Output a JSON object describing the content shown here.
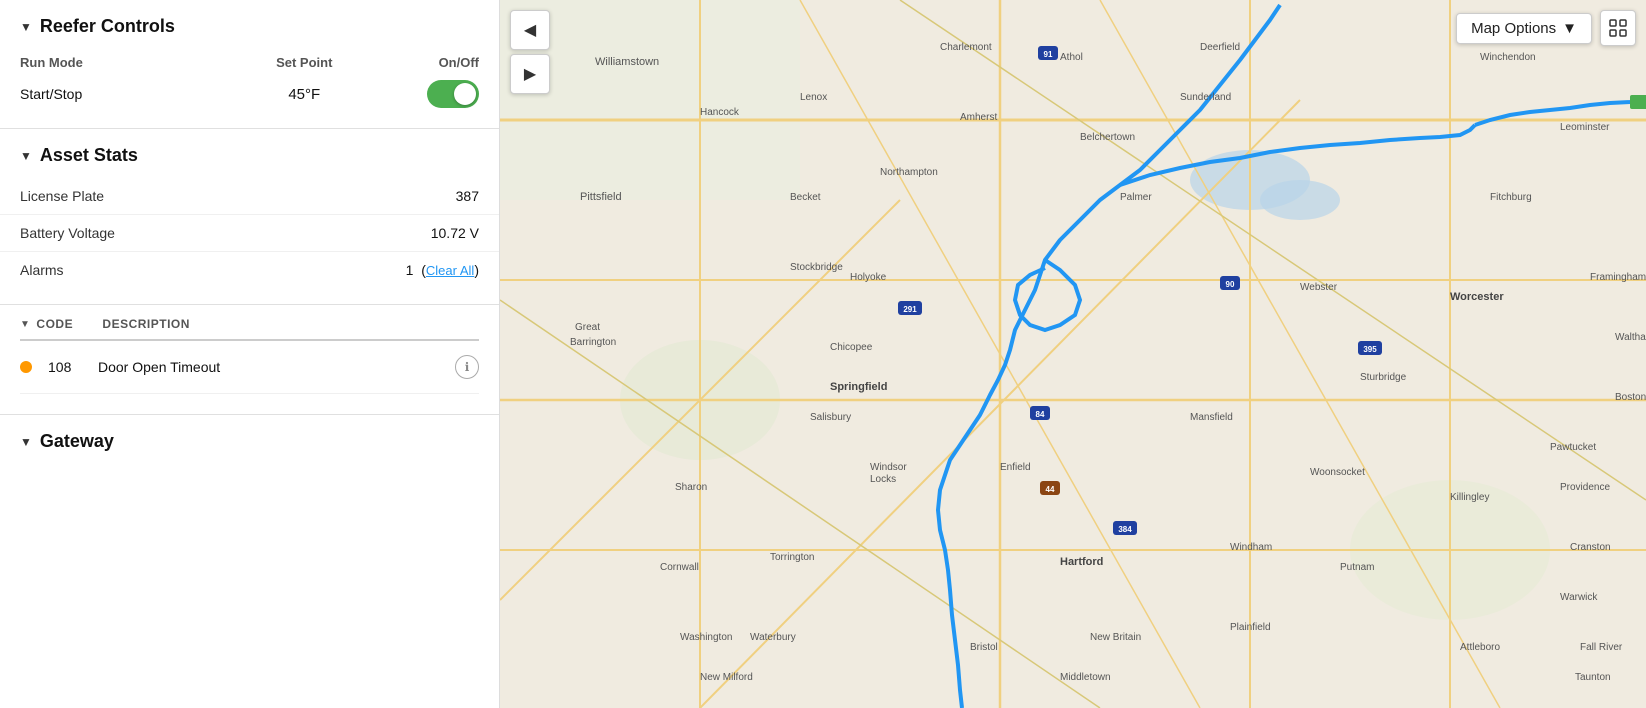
{
  "left_panel": {
    "reefer_controls": {
      "title": "Reefer Controls",
      "run_mode_label": "Run Mode",
      "set_point_label": "Set Point",
      "on_off_label": "On/Off",
      "start_stop_label": "Start/Stop",
      "set_point_value": "45°F",
      "toggle_on": true
    },
    "asset_stats": {
      "title": "Asset Stats",
      "rows": [
        {
          "label": "License Plate",
          "value": "387"
        },
        {
          "label": "Battery Voltage",
          "value": "10.72 V"
        },
        {
          "label": "Alarms",
          "value": "1",
          "clear_link": "Clear All"
        }
      ]
    },
    "alarms": {
      "code_col": "CODE",
      "desc_col": "DESCRIPTION",
      "items": [
        {
          "code": "108",
          "description": "Door Open Timeout",
          "dot_color": "#FF9800"
        }
      ]
    },
    "gateway": {
      "title": "Gateway"
    }
  },
  "map": {
    "options_label": "Map Options",
    "chevron": "▼",
    "back_icon": "◀",
    "play_icon": "▶",
    "expand_icon": "⛶"
  }
}
